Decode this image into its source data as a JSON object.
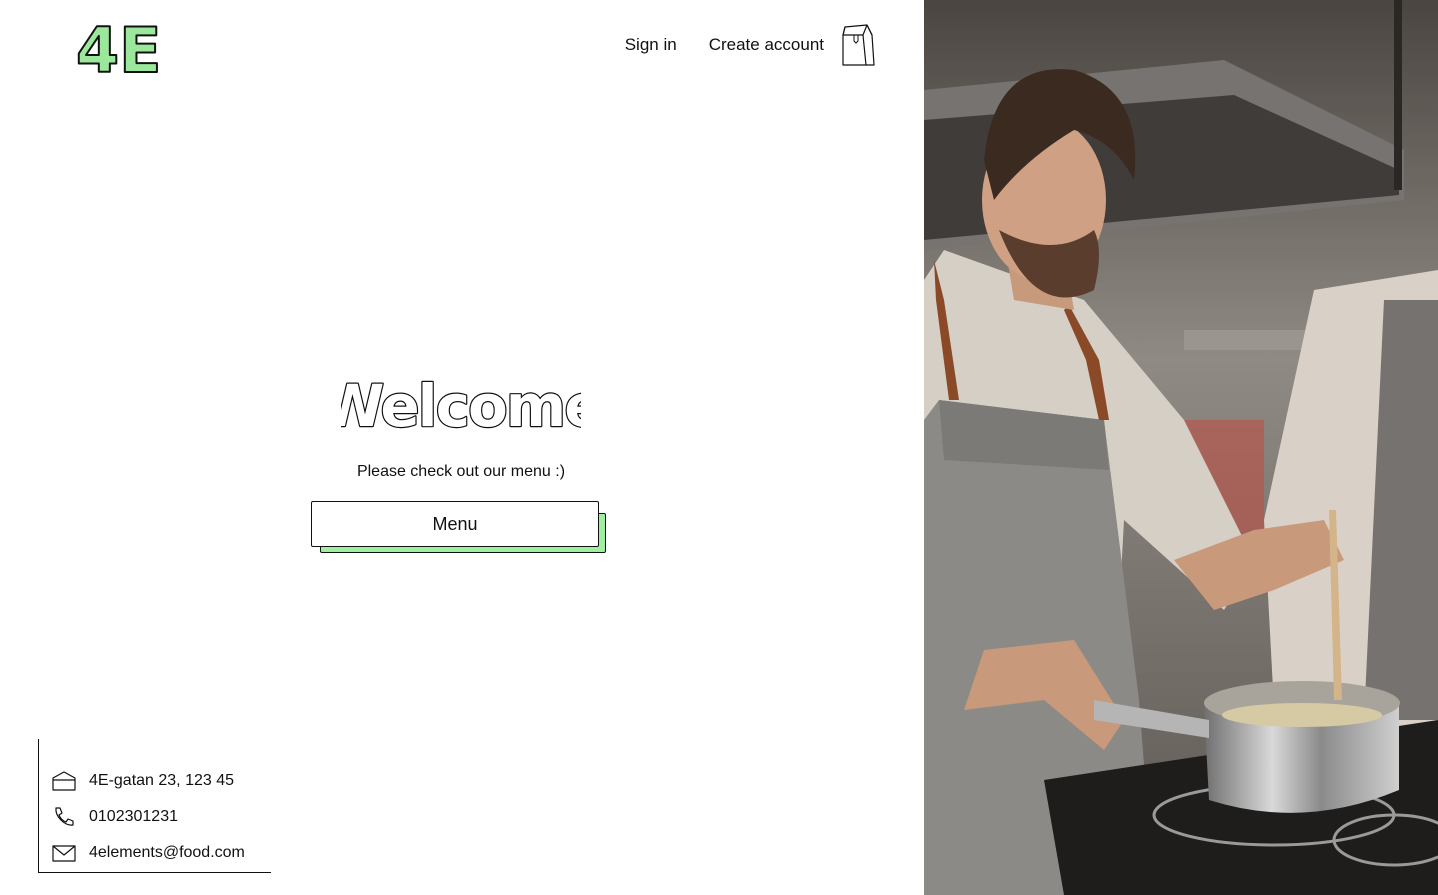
{
  "header": {
    "logo_text": "4E",
    "nav": {
      "sign_in": "Sign in",
      "create_account": "Create account"
    },
    "cart_icon": "shopping-bag-icon"
  },
  "hero": {
    "title": "Welcome",
    "subtitle": "Please check out our menu :)",
    "menu_button": "Menu"
  },
  "contact": {
    "address": "4E-gatan 23, 123 45",
    "phone": "0102301231",
    "email": "4elements@food.com",
    "address_icon": "house-icon",
    "phone_icon": "phone-icon",
    "email_icon": "envelope-icon"
  },
  "photo": {
    "subject": "chef cooking in kitchen"
  },
  "colors": {
    "accent": "#9ef0a0",
    "logo_fill": "#9be89c",
    "text": "#111111",
    "background": "#ffffff"
  }
}
